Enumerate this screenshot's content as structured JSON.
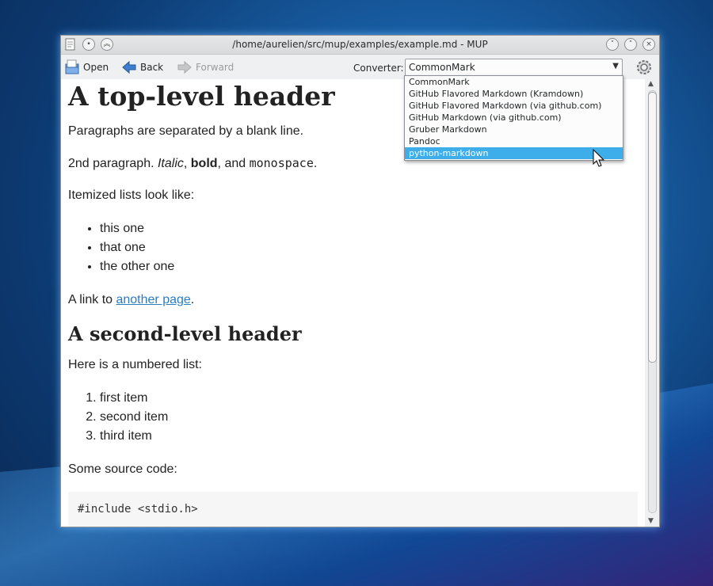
{
  "window": {
    "title": "/home/aurelien/src/mup/examples/example.md - MUP"
  },
  "toolbar": {
    "open_label": "Open",
    "back_label": "Back",
    "forward_label": "Forward",
    "converter_label": "Converter:",
    "converter_value": "CommonMark"
  },
  "converter_options": [
    "CommonMark",
    "GitHub Flavored Markdown (Kramdown)",
    "GitHub Flavored Markdown (via github.com)",
    "GitHub Markdown (via github.com)",
    "Gruber Markdown",
    "Pandoc",
    "python-markdown"
  ],
  "converter_highlighted": "python-markdown",
  "document": {
    "h1": "A top-level header",
    "p1": "Paragraphs are separated by a blank line.",
    "p2_prefix": "2nd paragraph. ",
    "p2_italic": "Italic",
    "p2_sep1": ", ",
    "p2_bold": "bold",
    "p2_sep2": ", and ",
    "p2_mono": "monospace",
    "p2_end": ".",
    "p3": "Itemized lists look like:",
    "bullets": [
      "this one",
      "that one",
      "the other one"
    ],
    "link_prefix": "A link to ",
    "link_text": "another page",
    "link_suffix": ".",
    "h2": "A second-level header",
    "p4": "Here is a numbered list:",
    "numbered": [
      "first item",
      "second item",
      "third item"
    ],
    "p5": "Some source code:",
    "code": "#include <stdio.h>"
  },
  "colors": {
    "highlight": "#3daee9",
    "link": "#2c7cc0"
  }
}
